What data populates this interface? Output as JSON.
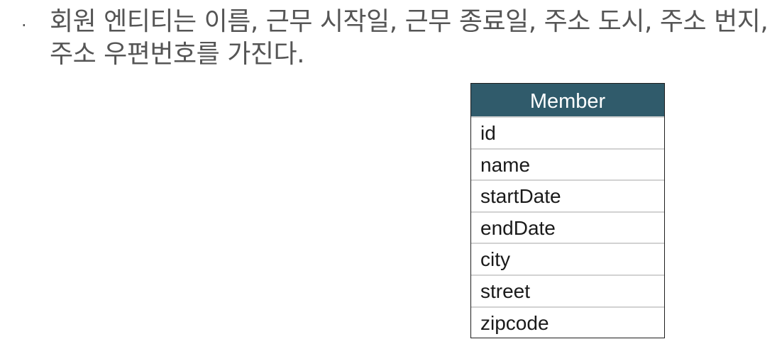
{
  "description": {
    "bullet": "·",
    "text": "회원 엔티티는 이름, 근무 시작일, 근무 종료일, 주소 도시, 주소 번지, 주소 우편번호를 가진다."
  },
  "entity": {
    "name": "Member",
    "header_color": "#305b6b",
    "attributes": [
      "id",
      "name",
      "startDate",
      "endDate",
      "city",
      "street",
      "zipcode"
    ]
  }
}
